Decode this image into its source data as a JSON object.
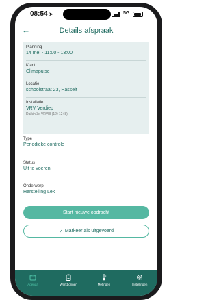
{
  "status": {
    "time": "08:54",
    "network": "5G"
  },
  "header": {
    "back_icon": "arrow-left-icon",
    "title": "Details afspraak"
  },
  "card": {
    "planning": {
      "label": "Planning",
      "value": "14 mei - 11:00 - 13:00"
    },
    "client": {
      "label": "Klant",
      "value": "Climapulse"
    },
    "location": {
      "label": "Locatie",
      "value": "schoolstraat 23, Hasselt"
    },
    "installation": {
      "label": "Installatie",
      "value": "VRV Verdiep",
      "sub": "Daikin 3x VRVIII (12+12+8)"
    }
  },
  "type": {
    "label": "Type",
    "value": "Periodieke controle"
  },
  "status_field": {
    "label": "Status",
    "value": "Uit te voeren"
  },
  "subject": {
    "label": "Onderwerp",
    "value": "Herstelling Lek"
  },
  "actions": {
    "primary": "Start nieuwe opdracht",
    "secondary": "Markeer als uitgevoerd"
  },
  "tabs": [
    {
      "label": "Agenda",
      "icon": "calendar-icon"
    },
    {
      "label": "Werkbonnen",
      "icon": "clipboard-icon"
    },
    {
      "label": "Metingen",
      "icon": "thermometer-icon"
    },
    {
      "label": "Instellingen",
      "icon": "gear-icon"
    }
  ],
  "colors": {
    "brand": "#1f6b60",
    "accent": "#55b8a2",
    "card_bg": "#e6efef"
  }
}
